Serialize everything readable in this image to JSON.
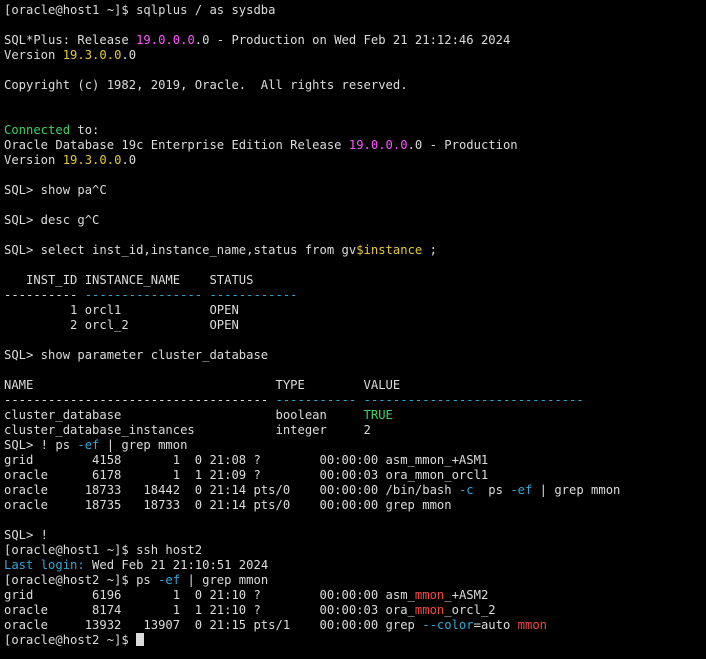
{
  "window": {
    "theme": {
      "background": "#000000",
      "foreground": "#dcdcdc"
    },
    "palette": {
      "magenta": "#ff55ff",
      "yellow": "#e5c93a",
      "green": "#3fd163",
      "cyan": "#2fa8d6",
      "red": "#f04848"
    }
  },
  "terminal": {
    "lines": [
      [
        {
          "t": "[oracle@host1 ~]$ sqlplus / as sysdba"
        }
      ],
      [],
      [
        {
          "t": "SQL*Plus: Release "
        },
        {
          "t": "19.0.0.0",
          "c": "magenta"
        },
        {
          "t": ".0 - Production on Wed Feb 21 21:12:46 2024"
        }
      ],
      [
        {
          "t": "Version "
        },
        {
          "t": "19.3.0.0",
          "c": "yellow"
        },
        {
          "t": ".0"
        }
      ],
      [],
      [
        {
          "t": "Copyright (c) 1982, 2019, Oracle.  All rights reserved."
        }
      ],
      [],
      [],
      [
        {
          "t": "Connected",
          "c": "green"
        },
        {
          "t": " to:"
        }
      ],
      [
        {
          "t": "Oracle Database 19c Enterprise Edition Release "
        },
        {
          "t": "19.0.0.0",
          "c": "magenta"
        },
        {
          "t": ".0 - Production"
        }
      ],
      [
        {
          "t": "Version "
        },
        {
          "t": "19.3.0.0",
          "c": "yellow"
        },
        {
          "t": ".0"
        }
      ],
      [],
      [
        {
          "t": "SQL> show pa^C"
        }
      ],
      [],
      [
        {
          "t": "SQL> desc g^C"
        }
      ],
      [],
      [
        {
          "t": "SQL> select inst_id,instance_name,status from gv"
        },
        {
          "t": "$instance",
          "c": "yellow"
        },
        {
          "t": " ;"
        }
      ],
      [],
      [
        {
          "t": "   INST_ID INSTANCE_NAME    STATUS"
        }
      ],
      [
        {
          "t": "---------- "
        },
        {
          "t": "---------------- ------------",
          "c": "cyan"
        }
      ],
      [
        {
          "t": "         1 orcl1            OPEN"
        }
      ],
      [
        {
          "t": "         2 orcl_2           OPEN"
        }
      ],
      [],
      [
        {
          "t": "SQL> show parameter cluster_database"
        }
      ],
      [],
      [
        {
          "t": "NAME                                 TYPE        VALUE"
        }
      ],
      [
        {
          "t": "------------------------------------ "
        },
        {
          "t": "----------- ------------------------------",
          "c": "cyan"
        }
      ],
      [
        {
          "t": "cluster_database                     boolean     "
        },
        {
          "t": "TRUE",
          "c": "green"
        }
      ],
      [
        {
          "t": "cluster_database_instances           integer     2"
        }
      ],
      [
        {
          "t": "SQL> ! ps "
        },
        {
          "t": "-ef",
          "c": "cyan"
        },
        {
          "t": " | grep mmon"
        }
      ],
      [
        {
          "t": "grid        4158       1  0 21:08 ?        00:00:00 asm_mmon_+ASM1"
        }
      ],
      [
        {
          "t": "oracle      6178       1  1 21:09 ?        00:00:03 ora_mmon_orcl1"
        }
      ],
      [
        {
          "t": "oracle     18733   18442  0 21:14 pts/0    00:00:00 /bin/bash "
        },
        {
          "t": "-c",
          "c": "cyan"
        },
        {
          "t": "  ps "
        },
        {
          "t": "-ef",
          "c": "cyan"
        },
        {
          "t": " | grep mmon"
        }
      ],
      [
        {
          "t": "oracle     18735   18733  0 21:14 pts/0    00:00:00 grep mmon"
        }
      ],
      [],
      [
        {
          "t": "SQL> !"
        }
      ],
      [
        {
          "t": "[oracle@host1 ~]$ ssh host2"
        }
      ],
      [
        {
          "t": "Last login:",
          "c": "cyan"
        },
        {
          "t": " Wed Feb 21 21:10:51 2024"
        }
      ],
      [
        {
          "t": "[oracle@host2 ~]$ ps "
        },
        {
          "t": "-ef",
          "c": "cyan"
        },
        {
          "t": " | grep mmon"
        }
      ],
      [
        {
          "t": "grid        6196       1  0 21:10 ?        00:00:00 asm_"
        },
        {
          "t": "mmon",
          "c": "red"
        },
        {
          "t": "_+ASM2"
        }
      ],
      [
        {
          "t": "oracle      8174       1  1 21:10 ?        00:00:03 ora_"
        },
        {
          "t": "mmon",
          "c": "red"
        },
        {
          "t": "_orcl_2"
        }
      ],
      [
        {
          "t": "oracle     13932   13907  0 21:15 pts/1    00:00:00 grep "
        },
        {
          "t": "--color",
          "c": "cyan"
        },
        {
          "t": "=auto "
        },
        {
          "t": "mmon",
          "c": "red"
        }
      ],
      [
        {
          "t": "[oracle@host2 ~]$ "
        },
        {
          "cursor": true
        }
      ]
    ]
  }
}
